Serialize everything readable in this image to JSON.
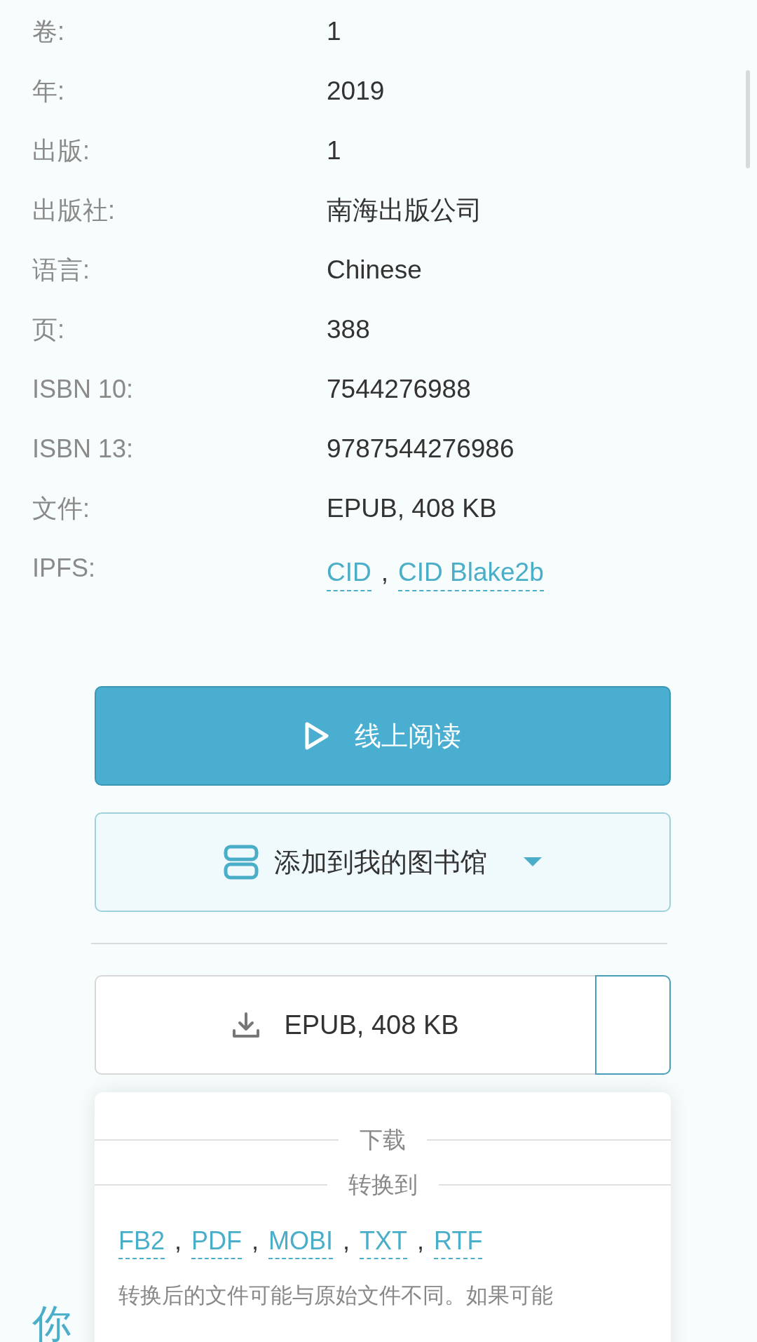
{
  "details": [
    {
      "label": "卷:",
      "value": "1"
    },
    {
      "label": "年:",
      "value": "2019"
    },
    {
      "label": "出版:",
      "value": "1"
    },
    {
      "label": "出版社:",
      "value": "南海出版公司"
    },
    {
      "label": "语言:",
      "value": "Chinese"
    },
    {
      "label": "页:",
      "value": "388"
    },
    {
      "label": "ISBN 10:",
      "value": "7544276988"
    },
    {
      "label": "ISBN 13:",
      "value": "9787544276986"
    },
    {
      "label": "文件:",
      "value": "EPUB, 408 KB"
    }
  ],
  "ipfs": {
    "label": "IPFS:",
    "links": [
      "CID",
      "CID Blake2b"
    ],
    "separator": ","
  },
  "read_button": {
    "label": "线上阅读"
  },
  "library_button": {
    "label": "添加到我的图书馆"
  },
  "download_button": {
    "label": "EPUB, 408 KB"
  },
  "section_heading": "你",
  "menu": {
    "download_heading": "下载",
    "convert_heading": "转换到",
    "formats": [
      "FB2",
      "PDF",
      "MOBI",
      "TXT",
      "RTF"
    ],
    "separator": ",",
    "note": "转换后的文件可能与原始文件不同。如果可能"
  }
}
